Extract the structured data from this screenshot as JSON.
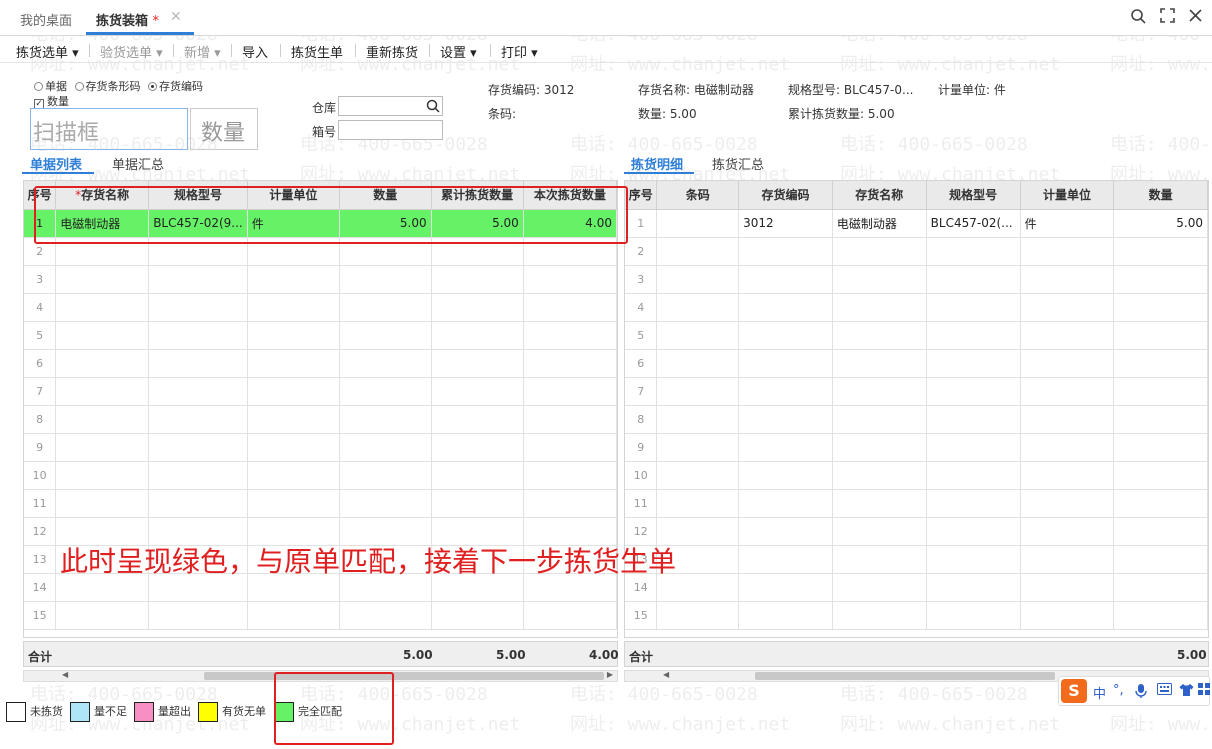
{
  "tabs": {
    "desk": "我的桌面",
    "pick": "拣货装箱",
    "pick_star": "*",
    "close": "✕"
  },
  "window_controls": {
    "search": "○",
    "maximize": "⛶",
    "close": "✕"
  },
  "toolbar": [
    {
      "label": "拣货选单 ▾",
      "enabled": true
    },
    {
      "label": "验货选单 ▾",
      "enabled": false
    },
    {
      "label": "新增 ▾",
      "enabled": false
    },
    {
      "label": "导入",
      "enabled": true
    },
    {
      "label": "拣货生单",
      "enabled": true
    },
    {
      "label": "重新拣货",
      "enabled": true
    },
    {
      "label": "设置 ▾",
      "enabled": true
    },
    {
      "label": "打印 ▾",
      "enabled": true
    }
  ],
  "form": {
    "radio_bill": "单据",
    "radio_barcode": "存货条形码",
    "radio_code": "存货编码",
    "check_qty": "数量",
    "scan_placeholder": "扫描框",
    "qty_placeholder": "数量",
    "warehouse_label": "仓库",
    "box_label": "箱号"
  },
  "info": {
    "code": "存货编码: 3012",
    "barcode": "条码:",
    "name": "存货名称: 电磁制动器",
    "qty": "数量: 5.00",
    "spec": "规格型号: BLC457-0...",
    "accum": "累计拣货数量: 5.00",
    "unit": "计量单位: 件"
  },
  "left_tabs": {
    "list": "单据列表",
    "summary": "单据汇总"
  },
  "right_tabs": {
    "detail": "拣货明细",
    "summary": "拣货汇总"
  },
  "left_grid": {
    "headers": [
      "序号",
      "存货名称",
      "规格型号",
      "计量单位",
      "数量",
      "累计拣货数量",
      "本次拣货数量"
    ],
    "required_mark": "*",
    "rows": [
      [
        "1",
        "电磁制动器",
        "BLC457-02(9...",
        "件",
        "5.00",
        "5.00",
        "4.00"
      ]
    ],
    "row_count": 15,
    "totals_label": "合计",
    "totals": [
      "5.00",
      "5.00",
      "4.00"
    ]
  },
  "right_grid": {
    "headers": [
      "序号",
      "条码",
      "存货编码",
      "存货名称",
      "规格型号",
      "计量单位",
      "数量"
    ],
    "rows": [
      [
        "1",
        "",
        "3012",
        "电磁制动器",
        "BLC457-02(...",
        "件",
        "5.00"
      ]
    ],
    "row_count": 15,
    "totals_label": "合计",
    "totals": [
      "5.00"
    ]
  },
  "legend": [
    {
      "label": "未拣货",
      "color": "#ffffff"
    },
    {
      "label": "量不足",
      "color": "#aee6f7"
    },
    {
      "label": "量超出",
      "color": "#f78fc4"
    },
    {
      "label": "有货无单",
      "color": "#ffff00"
    },
    {
      "label": "完全匹配",
      "color": "#66f266"
    }
  ],
  "annotation": "此时呈现绿色，与原单匹配，接着下一步拣货生单",
  "watermark": {
    "phone": "电话: 400-665-0028",
    "site": "网址: www.chanjet.net"
  },
  "ime": {
    "logo": "S",
    "lang": "中",
    "punct": "°,",
    "mic": "🎙",
    "kbd": "⌨",
    "skin": "👕",
    "grid": "▦"
  },
  "colors": {
    "accent": "#2f7fd8",
    "match_green": "#66f266",
    "annotation_red": "#e02020"
  }
}
